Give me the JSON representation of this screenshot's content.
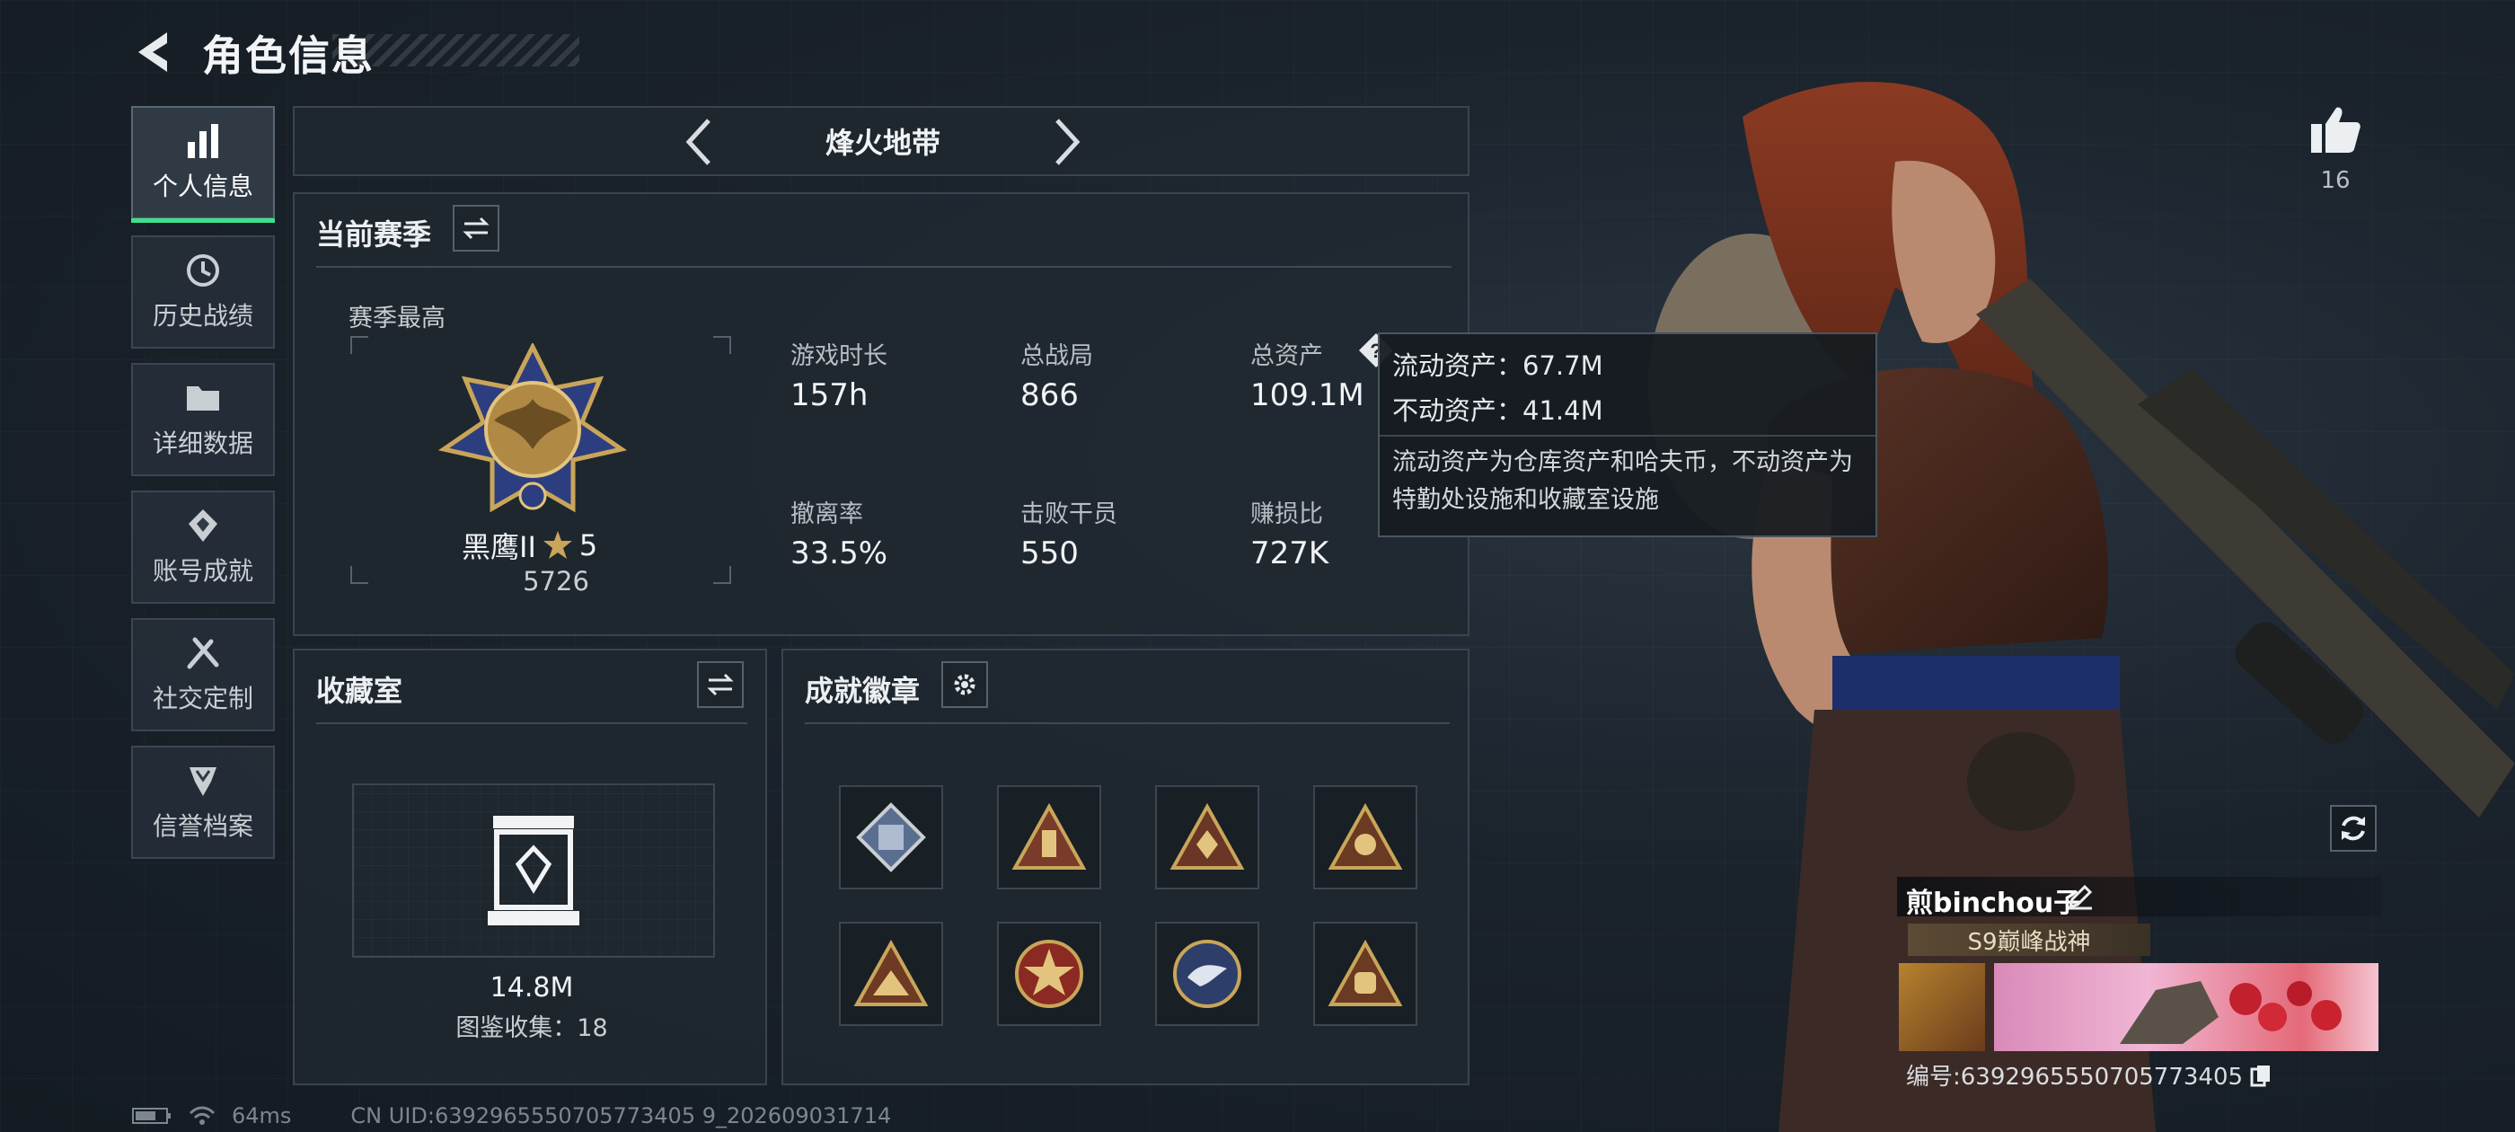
{
  "header": {
    "title": "角色信息"
  },
  "sidebar": {
    "items": [
      {
        "label": "个人信息",
        "icon": "bar-chart-icon",
        "active": true
      },
      {
        "label": "历史战绩",
        "icon": "history-icon"
      },
      {
        "label": "详细数据",
        "icon": "folder-icon"
      },
      {
        "label": "账号成就",
        "icon": "achievement-icon"
      },
      {
        "label": "社交定制",
        "icon": "tools-icon"
      },
      {
        "label": "信誉档案",
        "icon": "shield-rank-icon"
      }
    ]
  },
  "mode_switcher": {
    "label": "烽火地带"
  },
  "season": {
    "title": "当前赛季",
    "best_label": "赛季最高",
    "rank_name": "黑鹰II",
    "rank_stars": "5",
    "rank_points": "5726",
    "stats": [
      {
        "label": "游戏时长",
        "value": "157h"
      },
      {
        "label": "总战局",
        "value": "866"
      },
      {
        "label": "总资产",
        "value": "109.1M"
      },
      {
        "label": "撤离率",
        "value": "33.5%"
      },
      {
        "label": "击败干员",
        "value": "550"
      },
      {
        "label": "赚损比",
        "value": "727K"
      }
    ]
  },
  "tooltip": {
    "liquid": "流动资产：67.7M",
    "fixed": "不动资产：41.4M",
    "desc": "流动资产为仓库资产和哈夫币，不动资产为特勤处设施和收藏室设施"
  },
  "collection": {
    "title": "收藏室",
    "value": "14.8M",
    "catalog": "图鉴收集：18"
  },
  "badges": {
    "title": "成就徽章",
    "items": [
      "badge-1",
      "badge-2",
      "badge-3",
      "badge-4",
      "badge-5",
      "badge-6",
      "badge-7",
      "badge-8"
    ]
  },
  "profile": {
    "name": "煎binchou子",
    "title_badge": "S9巅峰战神",
    "id_label": "编号:6392965550705773405",
    "likes": "16"
  },
  "status_bar": {
    "ping": "64ms",
    "uid": "CN UID:6392965550705773405 9_202609031714"
  },
  "colors": {
    "accent": "#3ee08f",
    "gold": "#c9a55a",
    "panel": "#202830"
  }
}
